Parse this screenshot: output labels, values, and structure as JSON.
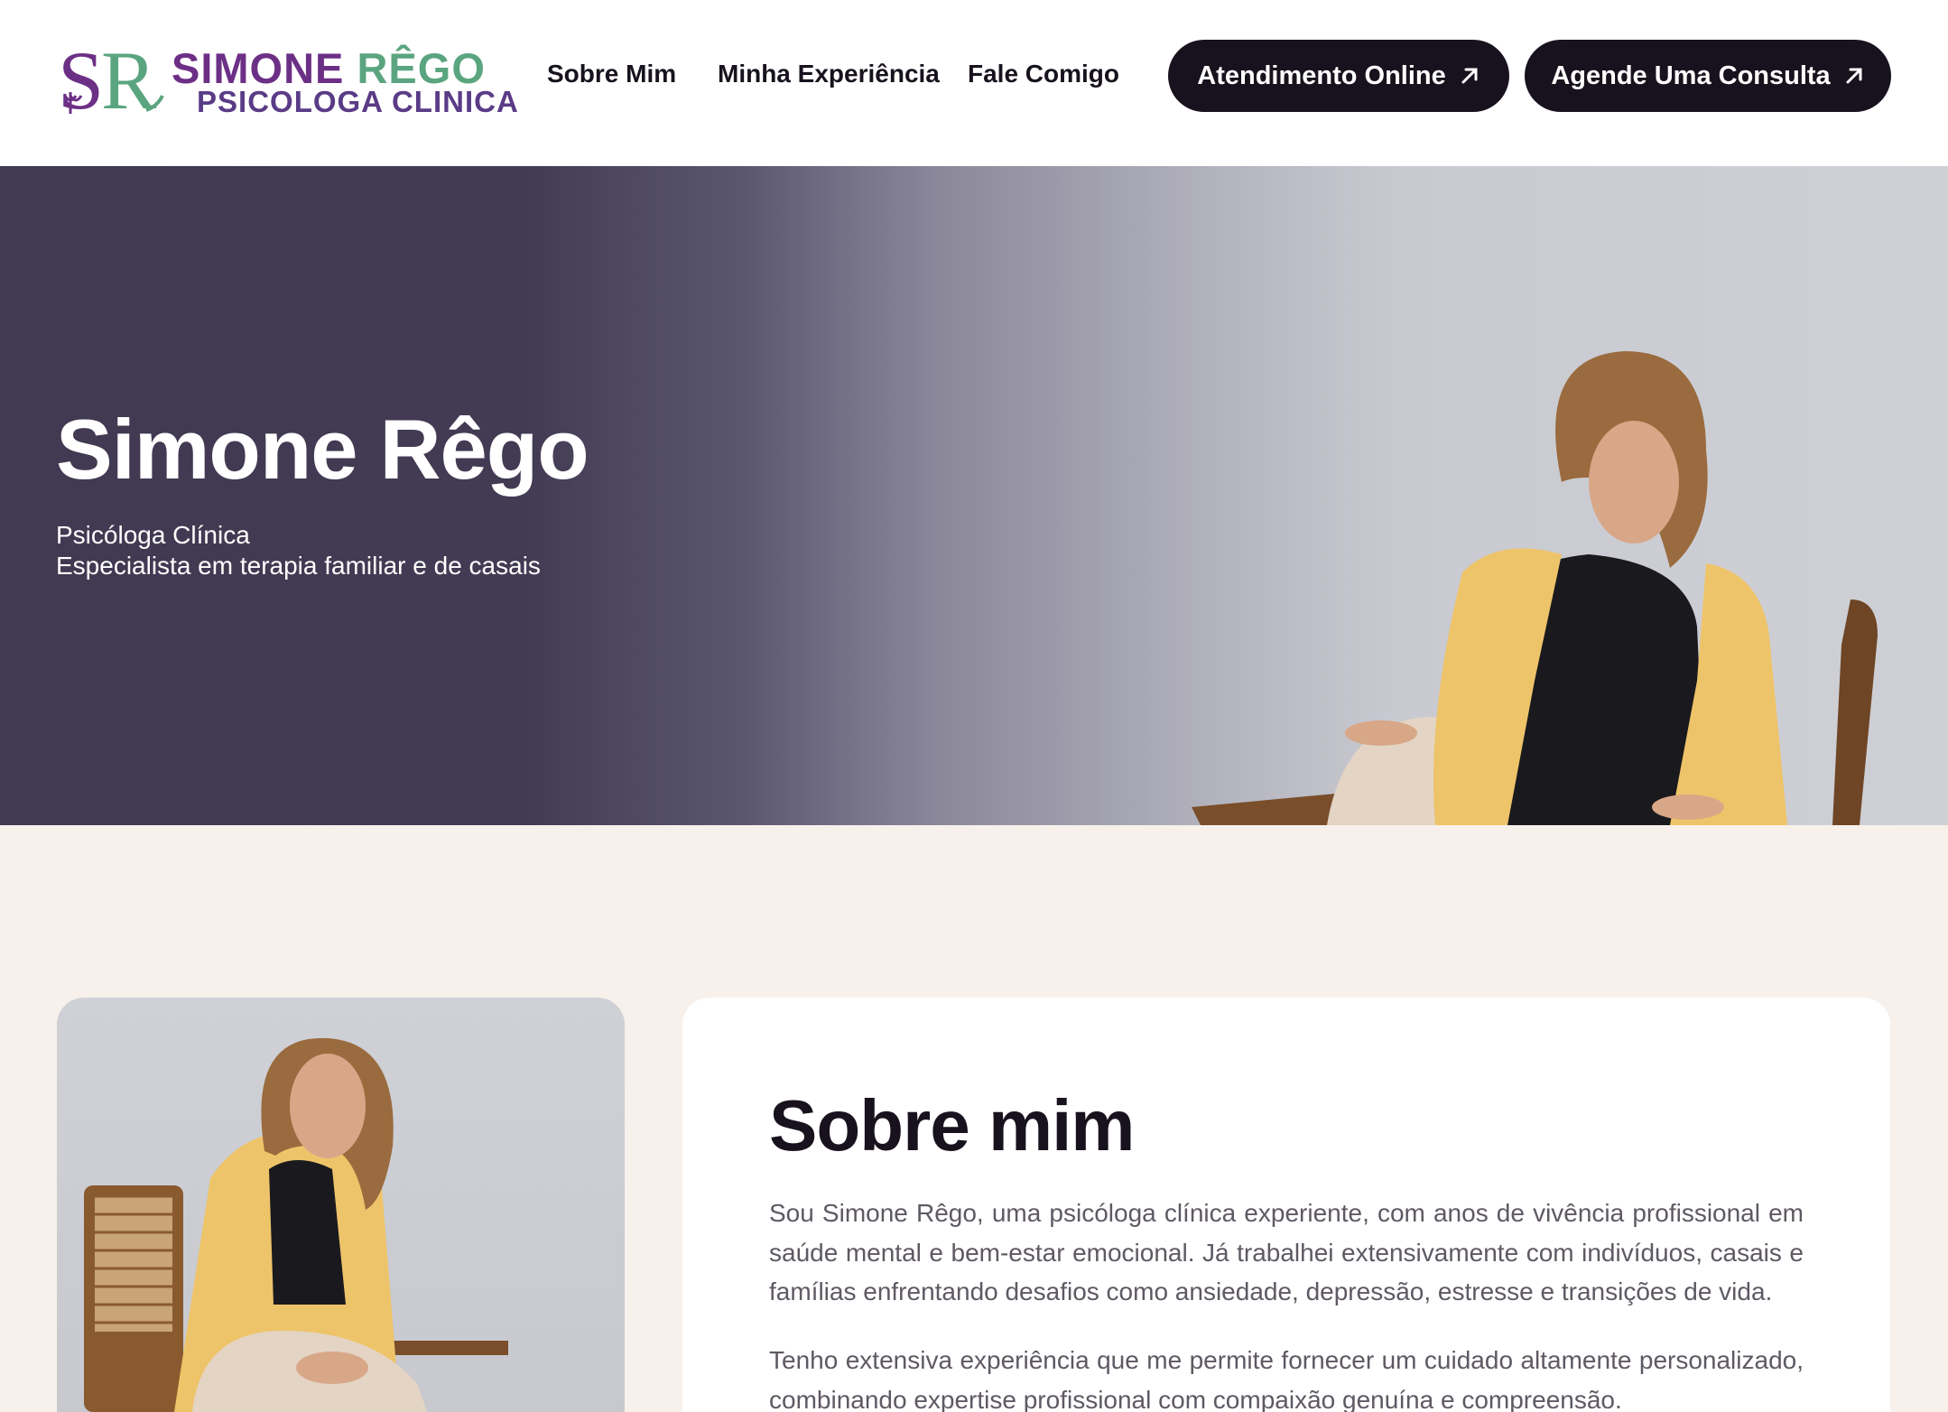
{
  "brand": {
    "monogram": "SR",
    "name_first": "SIMONE",
    "name_second": "RÊGO",
    "tagline": "PSICOLOGA CLINICA",
    "purple": "#6c2f86",
    "green": "#5aa57f"
  },
  "nav": {
    "items": [
      {
        "label": "Sobre Mim"
      },
      {
        "label": "Minha Experiência"
      },
      {
        "label": "Fale Comigo"
      }
    ]
  },
  "cta": {
    "online": "Atendimento Online",
    "consult": "Agende Uma Consulta",
    "icon": "arrow-up-right-icon",
    "background": "#17121d"
  },
  "hero": {
    "title": "Simone Rêgo",
    "subtitle_line1": "Psicóloga Clínica",
    "subtitle_line2": "Especialista em terapia familiar e de casais"
  },
  "about": {
    "title": "Sobre mim",
    "paragraph1": "Sou Simone Rêgo, uma psicóloga clínica experiente, com anos de vivência profissional em saúde mental e bem-estar emocional. Já trabalhei extensivamente com indivíduos, casais e famílias enfrentando desafios como ansiedade, depressão, estresse e transições de vida.",
    "paragraph2": "Tenho extensiva experiência que me permite fornecer um cuidado altamente personalizado, combinando expertise profissional com compaixão genuína e compreensão."
  }
}
